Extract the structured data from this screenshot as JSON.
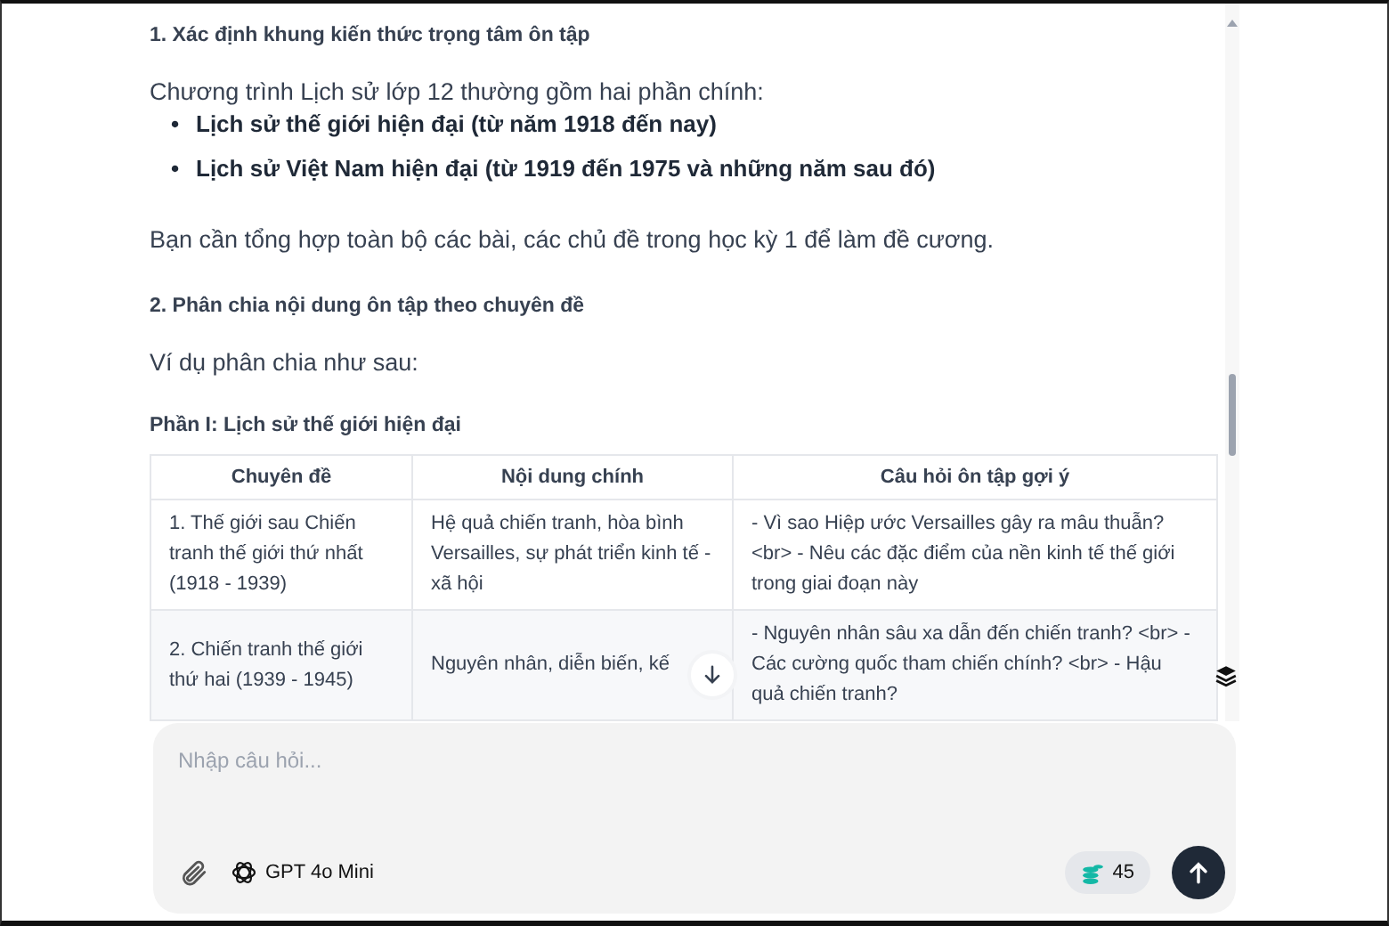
{
  "sections": [
    {
      "heading": "1. Xác định khung kiến thức trọng tâm ôn tập",
      "intro": "Chương trình Lịch sử lớp 12 thường gồm hai phần chính:",
      "bullets": [
        {
          "marker": "•",
          "text": "Lịch sử thế giới hiện đại (từ năm 1918 đến nay)"
        },
        {
          "marker": "•",
          "text": "Lịch sử Việt Nam hiện đại (từ 1919 đến 1975 và những năm sau đó)"
        }
      ],
      "outro": "Bạn cần tổng hợp toàn bộ các bài, các chủ đề trong học kỳ 1 để làm đề cương."
    },
    {
      "heading": "2. Phân chia nội dung ôn tập theo chuyên đề",
      "intro": "Ví dụ phân chia như sau:",
      "subheading": "Phần I: Lịch sử thế giới hiện đại"
    }
  ],
  "table": {
    "columns": [
      "Chuyên đề",
      "Nội dung chính",
      "Câu hỏi ôn tập gợi ý"
    ],
    "rows": [
      [
        "1. Thế giới sau Chiến tranh thế giới thứ nhất (1918 - 1939)",
        "Hệ quả chiến tranh, hòa bình Versailles, sự phát triển kinh tế - xã hội",
        "- Vì sao Hiệp ước Versailles gây ra mâu thuẫn? <br> - Nêu các đặc điểm của nền kinh tế thế giới trong giai đoạn này"
      ],
      [
        "2. Chiến tranh thế giới thứ hai (1939 - 1945)",
        "Nguyên nhân, diễn biến, kế",
        "- Nguyên nhân sâu xa dẫn đến chiến tranh? <br> - Các cường quốc tham chiến chính? <br> - Hậu quả chiến tranh?"
      ]
    ]
  },
  "composer": {
    "placeholder": "Nhập câu hỏi...",
    "model": "GPT 4o Mini",
    "credits": "45"
  }
}
